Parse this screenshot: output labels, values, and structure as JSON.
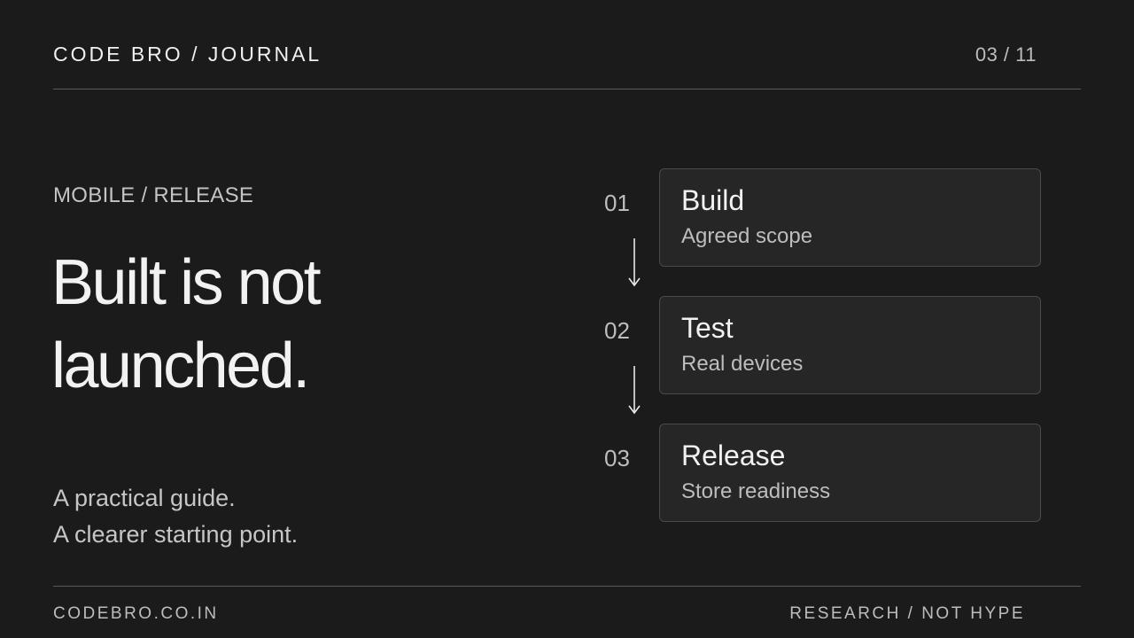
{
  "header": {
    "brand": "CODE BRO / JOURNAL",
    "page_indicator": "03 / 11"
  },
  "hero": {
    "eyebrow": "MOBILE / RELEASE",
    "headline_line1": "Built is not",
    "headline_line2": "launched.",
    "tagline_line1": "A practical guide.",
    "tagline_line2": "A clearer starting point."
  },
  "steps": [
    {
      "number": "01",
      "title": "Build",
      "subtitle": "Agreed scope"
    },
    {
      "number": "02",
      "title": "Test",
      "subtitle": "Real devices"
    },
    {
      "number": "03",
      "title": "Release",
      "subtitle": "Store readiness"
    }
  ],
  "footer": {
    "site": "CODEBRO.CO.IN",
    "motto": "RESEARCH / NOT HYPE"
  },
  "colors": {
    "background": "#1b1b1b",
    "card": "#262626",
    "text": "#f2f2f2",
    "muted": "#bdbdbd"
  }
}
